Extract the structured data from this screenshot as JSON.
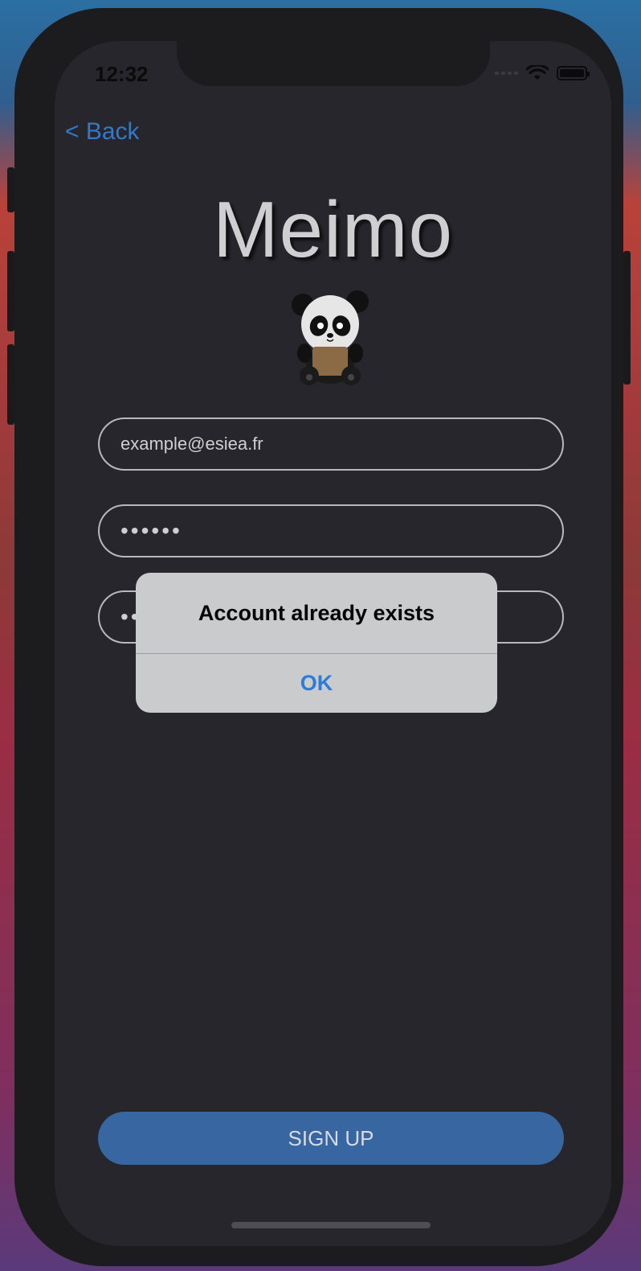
{
  "status_bar": {
    "time": "12:32"
  },
  "nav": {
    "back_label": "< Back"
  },
  "app": {
    "title": "Meimo"
  },
  "form": {
    "email_value": "example@esiea.fr",
    "password_value": "••••••",
    "confirm_password_value": "••••••"
  },
  "actions": {
    "signup_label": "SIGN UP"
  },
  "alert": {
    "title": "Account already exists",
    "ok_label": "OK"
  },
  "colors": {
    "accent": "#3478c8",
    "button": "#3766a0",
    "screen_bg": "#26262c",
    "alert_bg": "#cacbcd",
    "alert_button": "#2f7bd8"
  }
}
